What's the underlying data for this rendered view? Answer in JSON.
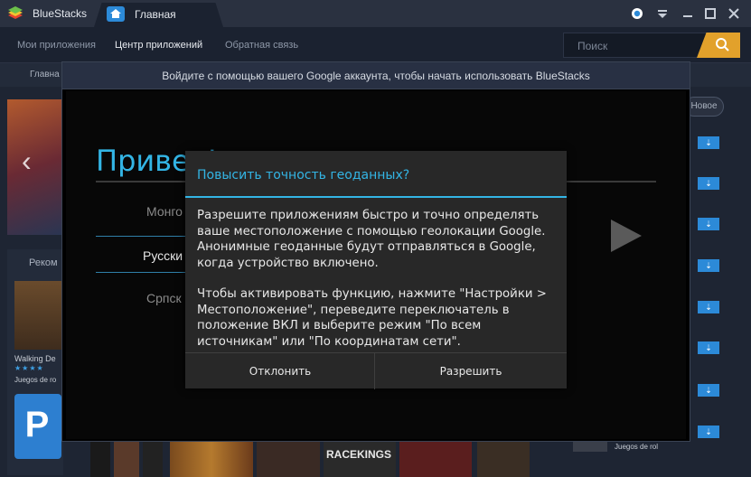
{
  "titlebar": {
    "brand": "BlueStacks",
    "tab": "Главная",
    "controls": [
      "location-icon",
      "menu-down-icon",
      "minimize-icon",
      "maximize-icon",
      "close-icon"
    ]
  },
  "nav": {
    "items": [
      "Мои приложения",
      "Центр приложений",
      "Обратная связь"
    ],
    "active_index": 1,
    "search_placeholder": "Поиск"
  },
  "background": {
    "subnav_home": "Главна",
    "rekom": "Реком",
    "game1_name": "Walking De",
    "game1_stars": "★★★★",
    "game1_category": "Juegos de ro",
    "new_label": "Новое",
    "bottom_right_category": "Juegos de rol",
    "racekings": "RACEKINGS"
  },
  "google_window": {
    "title": "Войдите с помощью вашего Google аккаунта, чтобы начать использовать BlueStacks",
    "welcome": "Привет!",
    "languages": [
      "Монго",
      "Русски",
      "Српск"
    ],
    "selected_language_index": 1
  },
  "dialog": {
    "title": "Повысить точность геоданных?",
    "paragraph1": "Разрешите приложениям быстро и точно определять ваше местоположение с помощью геолокации Google. Анонимные геоданные будут отправляться в Google, когда устройство включено.",
    "paragraph2": "Чтобы активировать функцию, нажмите \"Настройки > Местоположение\", переведите переключатель в положение ВКЛ и выберите режим \"По всем источникам\" или \"По координатам сети\".",
    "decline_label": "Отклонить",
    "allow_label": "Разрешить"
  },
  "colors": {
    "accent": "#33b5e5",
    "search_button": "#e2a12b",
    "titlebar": "#2a3140"
  }
}
